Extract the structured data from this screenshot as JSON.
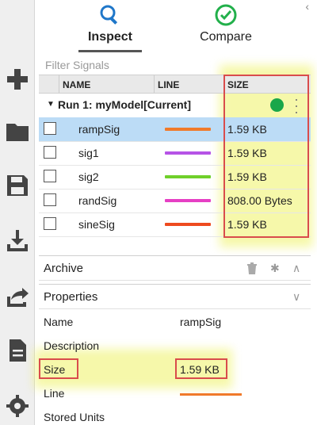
{
  "tabs": [
    {
      "label": "Inspect",
      "icon": "magnifier-icon",
      "active": true
    },
    {
      "label": "Compare",
      "icon": "checkmark-circle-icon",
      "active": false
    }
  ],
  "filter": {
    "placeholder": "Filter Signals"
  },
  "columns": [
    "NAME",
    "LINE",
    "SIZE"
  ],
  "run": {
    "title": "Run 1: myModel[Current]",
    "status_color": "#1aa74a"
  },
  "signals": [
    {
      "name": "rampSig",
      "line_color": "#f07a2a",
      "size": "1.59 KB",
      "selected": true
    },
    {
      "name": "sig1",
      "line_color": "#b653e6",
      "size": "1.59 KB",
      "selected": false
    },
    {
      "name": "sig2",
      "line_color": "#6fd02a",
      "size": "1.59 KB",
      "selected": false
    },
    {
      "name": "randSig",
      "line_color": "#e63fc4",
      "size": "808.00 Bytes",
      "selected": false
    },
    {
      "name": "sineSig",
      "line_color": "#ee4a1f",
      "size": "1.59 KB",
      "selected": false
    }
  ],
  "archive": {
    "label": "Archive"
  },
  "properties": {
    "label": "Properties",
    "rows": [
      {
        "key": "Name",
        "value": "rampSig"
      },
      {
        "key": "Description",
        "value": ""
      },
      {
        "key": "Size",
        "value": "1.59 KB"
      },
      {
        "key": "Line",
        "value": ""
      },
      {
        "key": "Stored Units",
        "value": ""
      }
    ],
    "line_color": "#f07a2a"
  },
  "toolbar": [
    "new-icon",
    "folder-icon",
    "save-icon",
    "import-icon",
    "export-icon",
    "report-icon",
    "settings-icon"
  ],
  "colors": {
    "highlight_border": "#d94c4c",
    "glow": "#eef264",
    "selection": "#bcdcf6",
    "accent_blue": "#1f77c9",
    "accent_green": "#22b04b"
  }
}
